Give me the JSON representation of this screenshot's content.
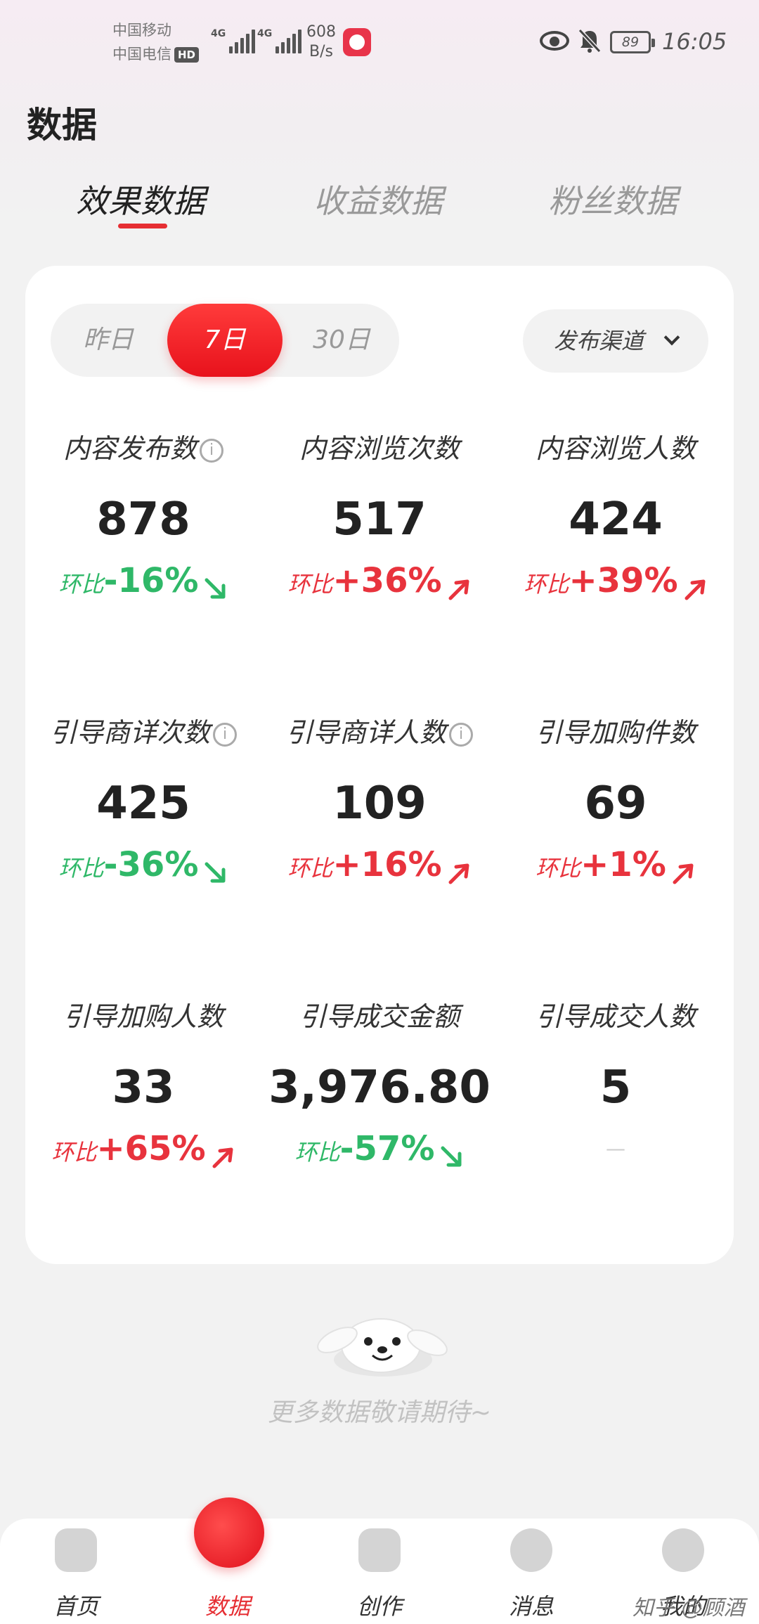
{
  "status_bar": {
    "carrier1": "中国移动",
    "carrier2": "中国电信",
    "hd": "HD",
    "signal1": "4G",
    "signal2": "4G",
    "net_speed_value": "608",
    "net_speed_unit": "B/s",
    "battery": "89",
    "time": "16:05"
  },
  "page": {
    "title": "数据"
  },
  "tabs": [
    {
      "label": "效果数据",
      "active": true
    },
    {
      "label": "收益数据",
      "active": false
    },
    {
      "label": "粉丝数据",
      "active": false
    }
  ],
  "period": {
    "options": [
      "昨日",
      "7日",
      "30日"
    ],
    "selected": "7日"
  },
  "channel_filter": {
    "label": "发布渠道"
  },
  "metrics": [
    {
      "label": "内容发布数",
      "info": true,
      "value": "878",
      "prefix": "环比",
      "change": "-16%",
      "trend": "down"
    },
    {
      "label": "内容浏览次数",
      "info": false,
      "value": "517",
      "prefix": "环比",
      "change": "+36%",
      "trend": "up"
    },
    {
      "label": "内容浏览人数",
      "info": false,
      "value": "424",
      "prefix": "环比",
      "change": "+39%",
      "trend": "up"
    },
    {
      "label": "引导商详次数",
      "info": true,
      "value": "425",
      "prefix": "环比",
      "change": "-36%",
      "trend": "down"
    },
    {
      "label": "引导商详人数",
      "info": true,
      "value": "109",
      "prefix": "环比",
      "change": "+16%",
      "trend": "up"
    },
    {
      "label": "引导加购件数",
      "info": false,
      "value": "69",
      "prefix": "环比",
      "change": "+1%",
      "trend": "up"
    },
    {
      "label": "引导加购人数",
      "info": false,
      "value": "33",
      "prefix": "环比",
      "change": "+65%",
      "trend": "up"
    },
    {
      "label": "引导成交金额",
      "info": false,
      "value": "3,976.80",
      "prefix": "环比",
      "change": "-57%",
      "trend": "down"
    },
    {
      "label": "引导成交人数",
      "info": false,
      "value": "5",
      "prefix": "",
      "change": "—",
      "trend": "none"
    }
  ],
  "footer_note": "更多数据敬请期待~",
  "bottom_nav": [
    {
      "label": "首页",
      "icon": "home-icon",
      "active": false
    },
    {
      "label": "数据",
      "icon": "data-chart-icon",
      "active": true
    },
    {
      "label": "创作",
      "icon": "plus-icon",
      "active": false
    },
    {
      "label": "消息",
      "icon": "message-icon",
      "active": false
    },
    {
      "label": "我的",
      "icon": "profile-icon",
      "active": false
    }
  ],
  "watermark": "知乎 @顾酒",
  "colors": {
    "accent": "#e62e33",
    "down": "#2fb868",
    "up": "#e8333d"
  }
}
